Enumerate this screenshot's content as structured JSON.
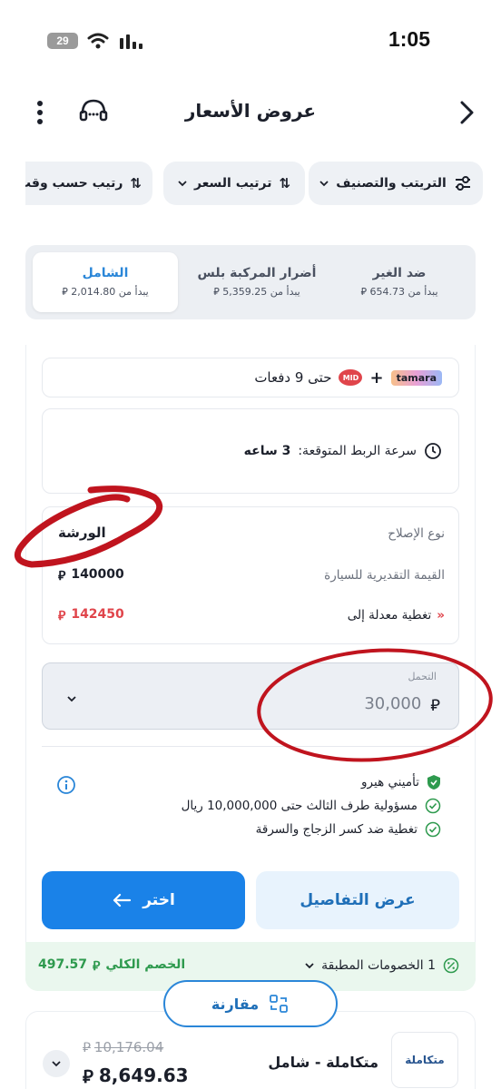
{
  "status_bar": {
    "battery": "29",
    "time": "1:05"
  },
  "header": {
    "title": "عروض الأسعار"
  },
  "filters": [
    {
      "label": "التريتب والتصنيف"
    },
    {
      "label": "ترتيب السعر"
    },
    {
      "label": "رتيب حسب وقت"
    }
  ],
  "tabs": [
    {
      "title": "ضد الغير",
      "subtitle": "يبدأ من 654.73 ⃁"
    },
    {
      "title": "أضرار المركبة بلس",
      "subtitle": "يبدأ من 5,359.25 ⃁"
    },
    {
      "title": "الشامل",
      "subtitle": "يبدأ من 2,014.80 ⃁"
    }
  ],
  "installments": {
    "tamara_label": "tamara",
    "mid_label": "MID",
    "text": "حتى 9 دفعات"
  },
  "link_speed": {
    "label": "سرعة الربط المتوقعة:",
    "value": "3 ساعه"
  },
  "details": {
    "repair_type_label": "نوع الإصلاح",
    "repair_type_value": "الورشة",
    "car_value_label": "القيمة التقديرية للسيارة",
    "car_value": "140000",
    "adjusted_label": "تغطية معدلة إلى",
    "adjusted_value": "142450"
  },
  "deductible": {
    "label": "التحمل",
    "value": "30,000"
  },
  "features": {
    "provider": "تأميني هيرو",
    "items": [
      "مسؤولية طرف الثالث حتى 10,000,000 ريال",
      "تغطية ضد كسر الزجاج والسرقة"
    ]
  },
  "buttons": {
    "details": "عرض التفاصيل",
    "choose": "اختر"
  },
  "discounts": {
    "applied": "1 الخصومات المطبقة",
    "total_label": "الخصم الكلي",
    "total_value": "497.57"
  },
  "compare_label": "مقارنة",
  "next_offer": {
    "name": "متكاملة - شامل",
    "logo_text": "متكاملة",
    "old_price": "10,176.04",
    "price": "8,649.63"
  },
  "currency_symbol": "⃁",
  "colors": {
    "primary": "#1a82e8",
    "accent_red": "#e0454b",
    "green": "#2e9a4e",
    "annotation": "#c0141e"
  }
}
